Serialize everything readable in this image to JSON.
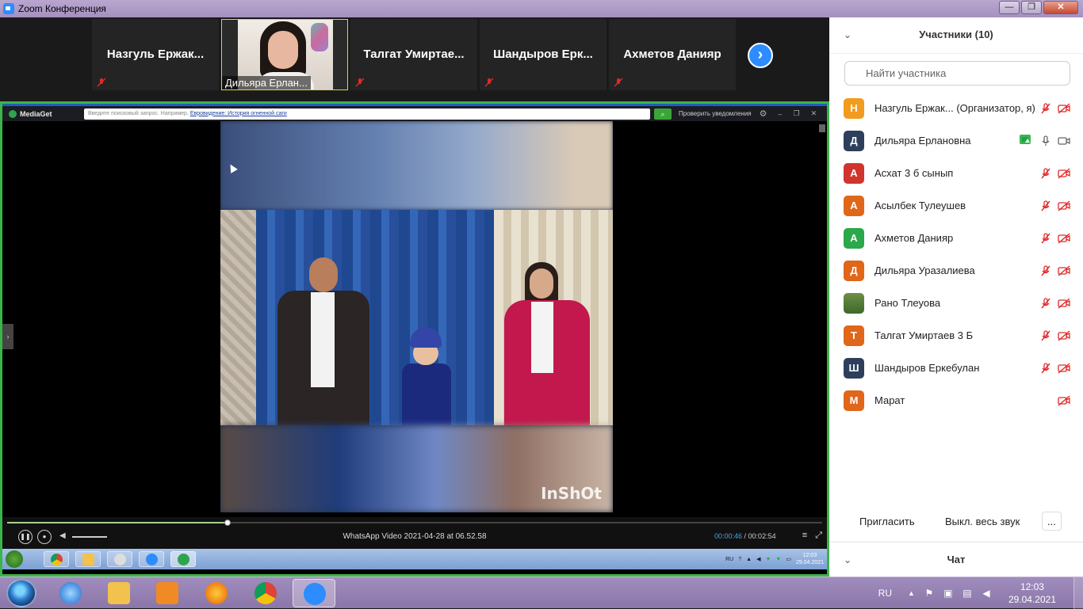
{
  "window": {
    "title": "Zoom Конференция",
    "minimize": "—",
    "maximize": "❐",
    "close": "✕"
  },
  "gallery": {
    "tiles": [
      {
        "name": "Назгуль  Ержак..."
      },
      {
        "name": "Дильяра Ерлан..."
      },
      {
        "name": "Талгат  Умиртае..."
      },
      {
        "name": "Шандыров  Ерк..."
      },
      {
        "name": "Ахметов Данияр"
      }
    ],
    "next": "›"
  },
  "mediaget": {
    "app_name": "MediaGet",
    "search_placeholder": "Введите поисковый запрос. Например, ",
    "search_example": "Евровидение: История огненной саги",
    "check_updates": "Проверить уведомления",
    "video_title": "WhatsApp Video 2021-04-28 at 06.52.58",
    "time_current": "00:00:46",
    "time_total": " / 00:02:54",
    "progress": 0.27,
    "watermark": "InShOt",
    "inner_tray_lang": "RU",
    "inner_clock_time": "12:03",
    "inner_clock_date": "29.04.2021"
  },
  "panel": {
    "title": "Участники (10)",
    "search_placeholder": "Найти участника",
    "participants": [
      {
        "initial": "Н",
        "name": "Назгуль Ержак... (Организатор, я)",
        "color": "#f29b1e",
        "mic": "muted",
        "cam": "off"
      },
      {
        "initial": "Д",
        "name": "Дильяра Ерлановна",
        "color": "#2e3f5c",
        "mic": "on",
        "cam": "on",
        "sharing": true
      },
      {
        "initial": "А",
        "name": "Асхат 3 б сынып",
        "color": "#d0342c",
        "mic": "muted",
        "cam": "off"
      },
      {
        "initial": "А",
        "name": "Асылбек Тулеушев",
        "color": "#e0661a",
        "mic": "muted",
        "cam": "off"
      },
      {
        "initial": "А",
        "name": "Ахметов Данияр",
        "color": "#2aa84a",
        "mic": "muted",
        "cam": "off"
      },
      {
        "initial": "Д",
        "name": "Дильяра Уразалиева",
        "color": "#e0661a",
        "mic": "muted",
        "cam": "off"
      },
      {
        "initial": "",
        "name": "Рано Тлеуова",
        "color": "photo",
        "mic": "muted",
        "cam": "off"
      },
      {
        "initial": "Т",
        "name": "Талгат Умиртаев 3 Б",
        "color": "#e0661a",
        "mic": "muted",
        "cam": "off"
      },
      {
        "initial": "Ш",
        "name": "Шандыров Еркебулан",
        "color": "#2e3f5c",
        "mic": "muted",
        "cam": "off"
      },
      {
        "initial": "М",
        "name": "Марат",
        "color": "#e0661a",
        "mic": "none",
        "cam": "off"
      }
    ],
    "buttons": {
      "invite": "Пригласить",
      "mute_all": "Выкл. весь звук",
      "more": "..."
    },
    "chat_title": "Чат"
  },
  "taskbar": {
    "lang": "RU",
    "time": "12:03",
    "date": "29.04.2021"
  },
  "colors": {
    "zoom_blue": "#2d8cff",
    "share_border": "#3bb44a",
    "muted_red": "#e02828"
  }
}
